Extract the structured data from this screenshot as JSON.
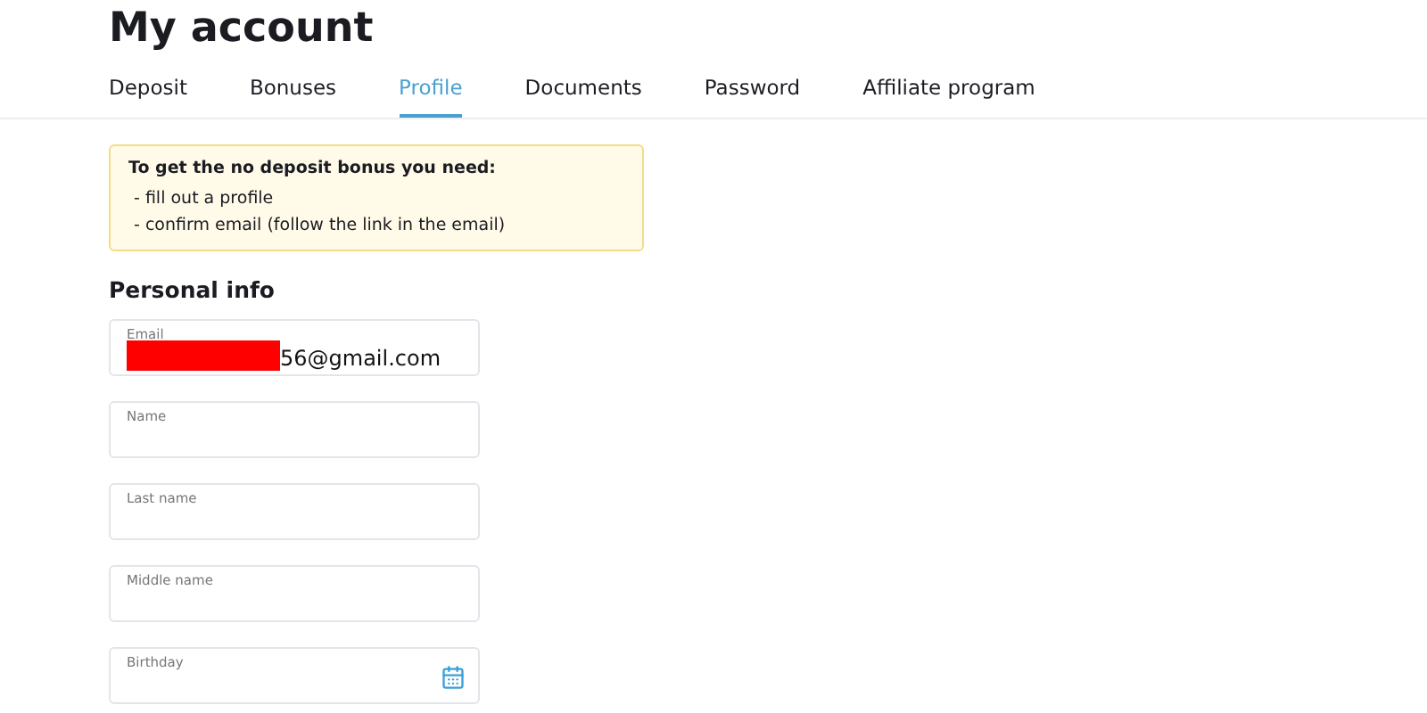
{
  "title": "My account",
  "tabs": [
    {
      "label": "Deposit",
      "selected": false
    },
    {
      "label": "Bonuses",
      "selected": false
    },
    {
      "label": "Profile",
      "selected": true
    },
    {
      "label": "Documents",
      "selected": false
    },
    {
      "label": "Password",
      "selected": false
    },
    {
      "label": "Affiliate program",
      "selected": false
    }
  ],
  "notice": {
    "heading": "To get the no deposit bonus you need:",
    "items": [
      "- fill out a profile",
      "- confirm email (follow the link in the email)"
    ]
  },
  "section_title": "Personal info",
  "fields": [
    {
      "kind": "text",
      "label": "Email",
      "value": "56@gmail.com",
      "redacted": true
    },
    {
      "kind": "text",
      "label": "Name"
    },
    {
      "kind": "text",
      "label": "Last name"
    },
    {
      "kind": "text",
      "label": "Middle name"
    },
    {
      "kind": "date",
      "label": "Birthday"
    }
  ]
}
